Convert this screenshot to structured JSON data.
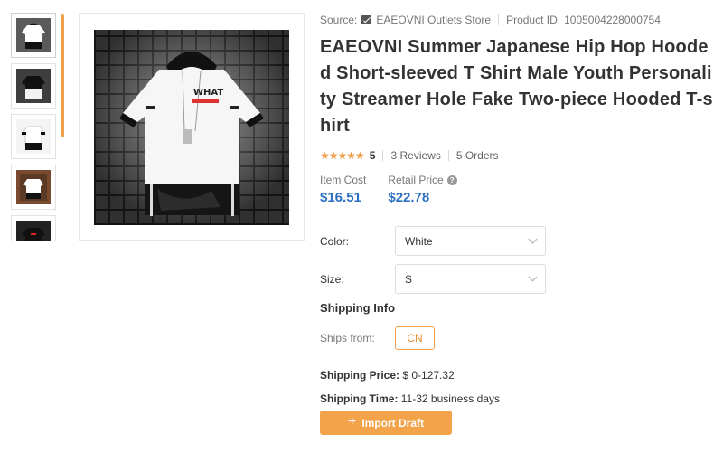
{
  "source": {
    "label": "Source:",
    "store_name": "EAEOVNI Outlets Store",
    "product_id_label": "Product ID:",
    "product_id": "1005004228000754"
  },
  "product": {
    "title": "EAEOVNI Summer Japanese Hip Hop Hooded Short-sleeved T Shirt Male Youth Personality Streamer Hole Fake Two-piece Hooded T-shirt",
    "rating_stars": "★★★★★",
    "rating": "5",
    "reviews": "3 Reviews",
    "orders": "5 Orders"
  },
  "prices": {
    "item_cost_label": "Item Cost",
    "item_cost": "$16.51",
    "retail_label": "Retail Price",
    "retail": "$22.78"
  },
  "options": {
    "color_label": "Color:",
    "color_value": "White",
    "size_label": "Size:",
    "size_value": "S"
  },
  "shipping": {
    "title": "Shipping Info",
    "ships_from_label": "Ships from:",
    "ships_from_value": "CN",
    "price_label": "Shipping Price:",
    "price_value": "$ 0-127.32",
    "time_label": "Shipping Time:",
    "time_value": "11-32 business days"
  },
  "actions": {
    "import_label": "Import Draft"
  },
  "colors": {
    "accent": "#f3a34a",
    "price": "#2a6fc0"
  }
}
